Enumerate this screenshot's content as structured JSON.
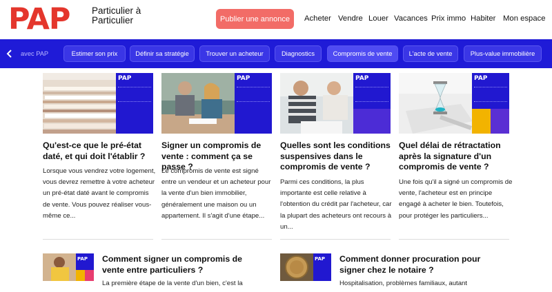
{
  "header": {
    "logo": "PAP",
    "tagline": "Particulier à Particulier",
    "publish_button": "Publier une annonce",
    "nav": [
      "Acheter",
      "Vendre",
      "Louer",
      "Vacances",
      "Prix immo",
      "Habiter",
      "Mon espace"
    ]
  },
  "subnav": {
    "back_icon": "chevron-left-icon",
    "items": [
      "avec PAP",
      "Estimer son prix",
      "Définir sa stratégie",
      "Trouver un acheteur",
      "Diagnostics",
      "Compromis de vente",
      "L'acte de vente",
      "Plus-value immobilière"
    ],
    "active": "Compromis de vente"
  },
  "colors": {
    "brand_red": "#e4362c",
    "bar_blue": "#1f1bd7",
    "publish": "#f26c67"
  },
  "cards": [
    {
      "title": "Qu'est-ce que le pré-état daté, et qui doit l'établir ?",
      "description": "Lorsque vous vendrez votre logement, vous devrez remettre à votre acheteur un pré-état daté avant le compromis de vente. Vous pouvez réaliser vous-même ce...",
      "badge": "PAP"
    },
    {
      "title": "Signer un compromis de vente : comment ça se passe ?",
      "description": "Le compromis de vente est signé entre un vendeur et un acheteur pour la vente d'un bien immobilier, généralement une maison ou un appartement. Il s'agit d'une étape...",
      "badge": "PAP"
    },
    {
      "title": "Quelles sont les conditions suspensives dans le compromis de vente ?",
      "description": "Parmi ces conditions, la plus importante est celle relative à l'obtention du crédit par l'acheteur, car la plupart des acheteurs ont recours à un...",
      "badge": "PAP"
    },
    {
      "title": "Quel délai de rétractation après la signature d'un compromis de vente ?",
      "description": "Une fois qu'il a signé un compromis de vente, l'acheteur est en principe engagé à acheter le bien. Toutefois, pour protéger les particuliers...",
      "badge": "PAP"
    }
  ],
  "small_cards": [
    {
      "title": "Comment signer un compromis de vente entre particuliers ?",
      "description": "La première étape de la vente d'un bien, c'est la",
      "badge": "PAP"
    },
    {
      "title": "Comment donner procuration pour signer chez le notaire ?",
      "description": "Hospitalisation, problèmes familiaux, autant",
      "badge": "PAP"
    }
  ]
}
